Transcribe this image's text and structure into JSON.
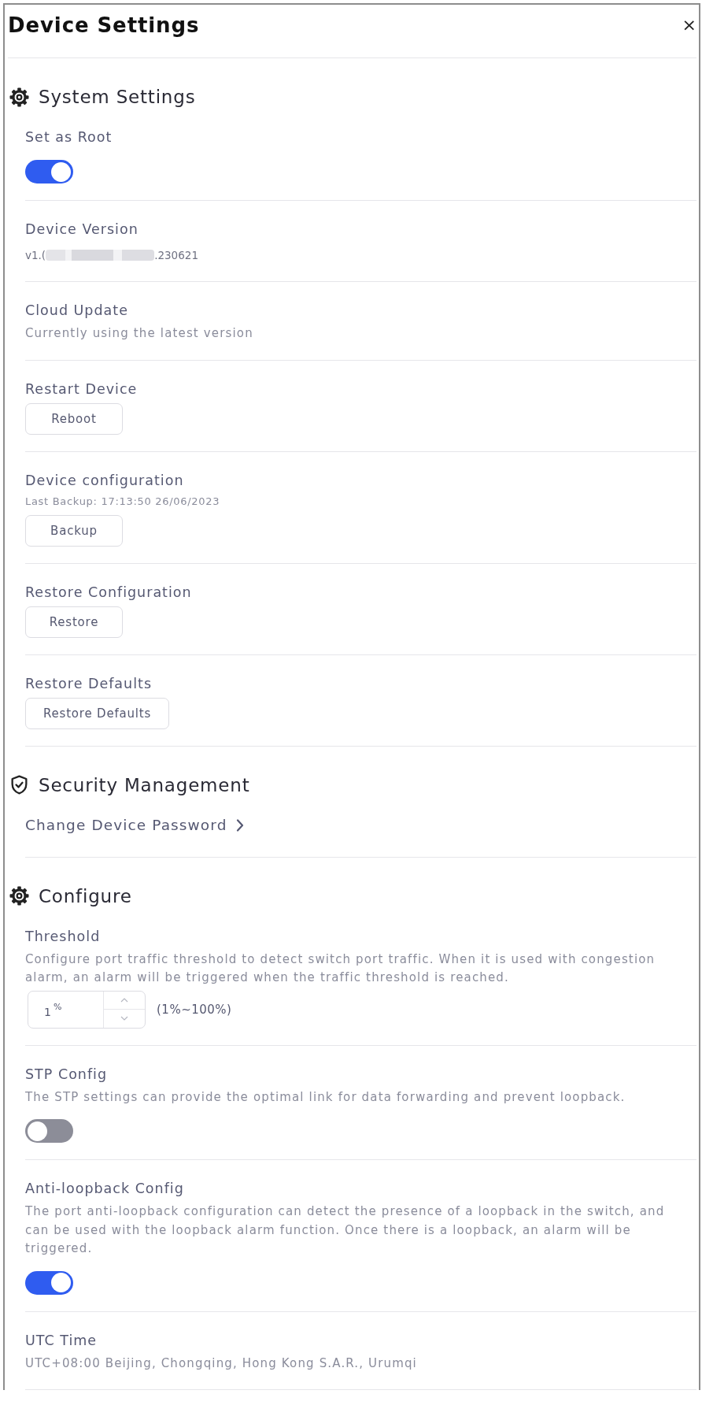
{
  "dialog": {
    "title": "Device Settings",
    "close": "×"
  },
  "system_settings": {
    "title": "System Settings",
    "items": [
      {
        "kind": "toggle",
        "label": "Set as Root",
        "on": true
      },
      {
        "kind": "redacted",
        "label": "Device Version",
        "value_start": "v1.(",
        "value_end": ".230621"
      },
      {
        "kind": "text",
        "label": "Cloud Update",
        "description": "Currently using the latest version"
      },
      {
        "kind": "button",
        "label": "Restart Device",
        "button": "Reboot"
      },
      {
        "kind": "button",
        "label": "Device configuration",
        "note": "Last Backup: 17:13:50 26/06/2023",
        "button": "Backup"
      },
      {
        "kind": "button",
        "label": "Restore Configuration",
        "button": "Restore"
      },
      {
        "kind": "button",
        "label": "Restore Defaults",
        "button": "Restore Defaults"
      }
    ]
  },
  "security_management": {
    "title": "Security Management",
    "items": [
      {
        "kind": "link",
        "label": "Change Device Password"
      }
    ]
  },
  "configure": {
    "title": "Configure",
    "items": [
      {
        "kind": "number",
        "label": "Threshold",
        "description": "Configure port traffic threshold to detect switch port traffic. When it is used with congestion alarm, an alarm will be triggered when the traffic threshold is reached.",
        "value": "1",
        "unit": "%",
        "range": "(1%~100%)"
      },
      {
        "kind": "toggle",
        "label": "STP Config",
        "description": "The STP settings can provide the optimal link for data forwarding and prevent loopback.",
        "on": false
      },
      {
        "kind": "toggle",
        "label": "Anti-loopback Config",
        "description": "The port anti-loopback configuration can detect the presence of a loopback in the switch, and can be used with the loopback alarm function. Once there is a loopback, an alarm will be triggered.",
        "on": true
      },
      {
        "kind": "text",
        "label": "UTC Time",
        "description": "UTC+08:00 Beijing, Chongqing, Hong Kong S.A.R., Urumqi"
      }
    ]
  }
}
